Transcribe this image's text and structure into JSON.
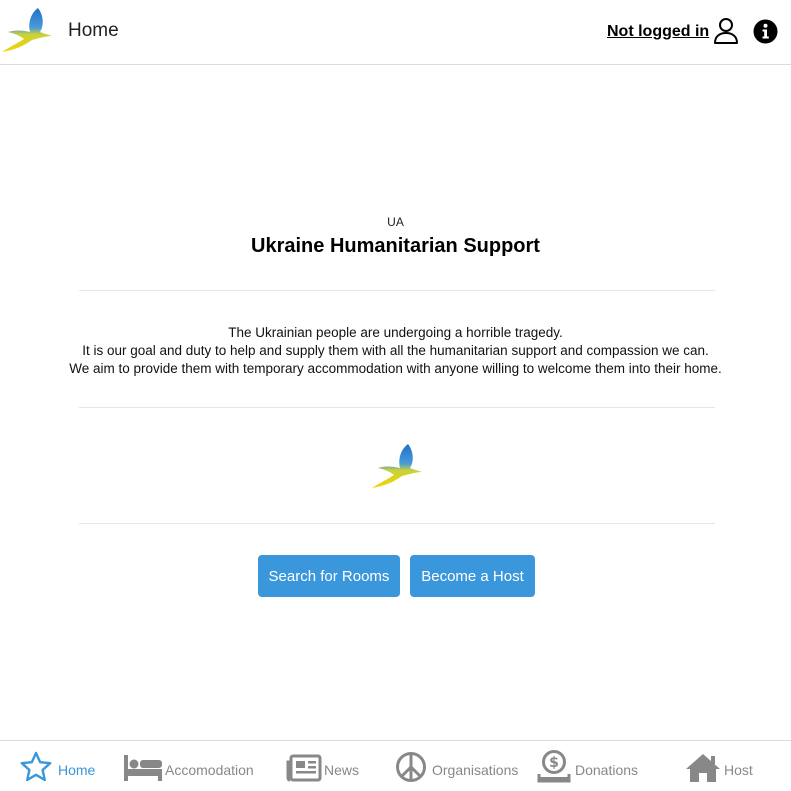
{
  "header": {
    "title": "Home",
    "login_status": "Not logged in"
  },
  "main": {
    "country_code": "UA",
    "headline": "Ukraine Humanitarian Support",
    "mission_lines": [
      "The Ukrainian people are undergoing a horrible tragedy.",
      "It is our goal and duty to help and supply them with all the humanitarian support and compassion we can.",
      "We aim to provide them with temporary accommodation with anyone willing to welcome them into their home."
    ],
    "buttons": {
      "search": "Search for Rooms",
      "host": "Become a Host"
    }
  },
  "nav": {
    "items": [
      {
        "label": "Home",
        "icon": "star-icon",
        "active": true
      },
      {
        "label": "Accomodation",
        "icon": "bed-icon",
        "active": false
      },
      {
        "label": "News",
        "icon": "newspaper-icon",
        "active": false
      },
      {
        "label": "Organisations",
        "icon": "peace-icon",
        "active": false
      },
      {
        "label": "Donations",
        "icon": "donate-icon",
        "active": false
      },
      {
        "label": "Host",
        "icon": "house-icon",
        "active": false
      }
    ]
  },
  "colors": {
    "accent": "#3a97db",
    "nav_inactive": "#888888",
    "logo_blue": "#1f6fc9",
    "logo_yellow": "#f3d400"
  }
}
